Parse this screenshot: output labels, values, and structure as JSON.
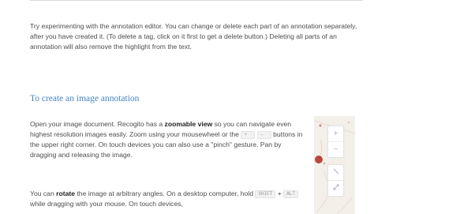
{
  "intro": {
    "text": "Try experimenting with the annotation editor. You can change or delete each part of an annotation separately, after you have created it. (To delete a tag, click on it first to get a delete button.) Deleting all parts of an annotation will also remove the highlight from the text."
  },
  "section": {
    "heading": "To create an image annotation",
    "p1_a": "Open your image document. Recogito has a ",
    "p1_b": "zoomable view",
    "p1_c": " so you can navigate even highest resolution images easily. Zoom using your mousewheel or the ",
    "p1_key1": "+",
    "p1_d": " ",
    "p1_key2": "–",
    "p1_e": " buttons in the upper right corner. On touch devices you can also use a \"pinch\" gesture. Pan by dragging and releasing the image.",
    "p2_a": "You can ",
    "p2_b": "rotate",
    "p2_c": " the image at arbitrary angles. On a desktop computer, hold ",
    "p2_key1": "SHIFT",
    "p2_d": " + ",
    "p2_key2": "ALT",
    "p2_e": " while dragging with your mouse. On touch devices,"
  },
  "map_controls": {
    "zoom_in": "+",
    "zoom_out": "−"
  },
  "colors": {
    "heading": "#4483c4",
    "map_bg": "#f3efe9",
    "marker": "#b9473c"
  },
  "icons": [
    "zoom-in-icon",
    "zoom-out-icon",
    "rotate-icon",
    "fullscreen-icon"
  ]
}
